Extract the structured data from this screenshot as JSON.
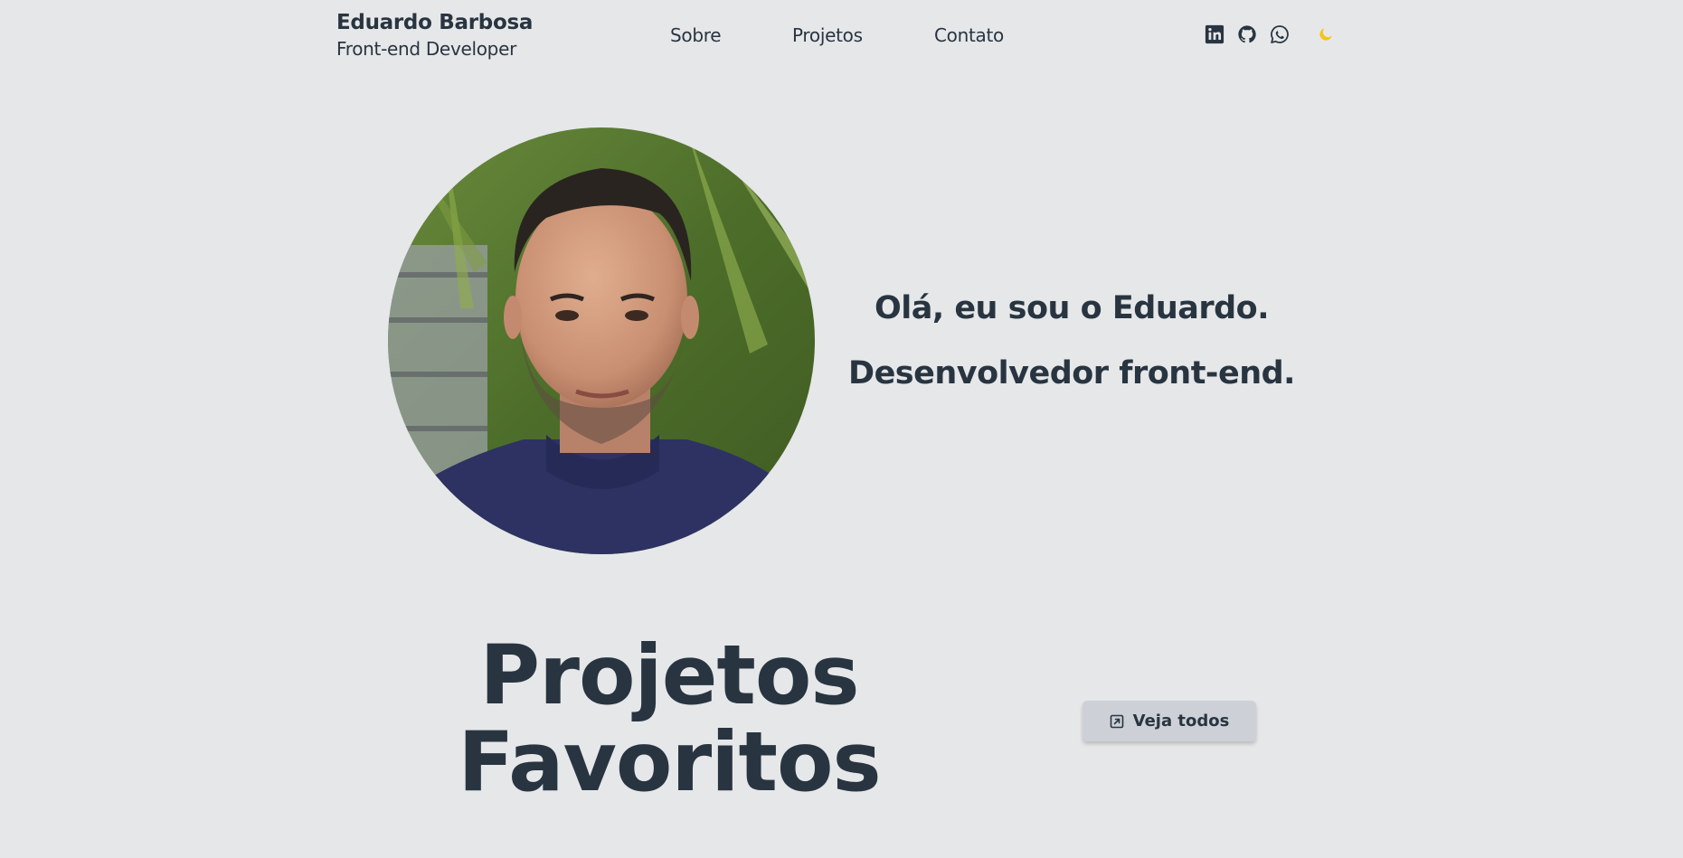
{
  "header": {
    "name": "Eduardo Barbosa",
    "role": "Front-end Developer",
    "nav": [
      "Sobre",
      "Projetos",
      "Contato"
    ],
    "social_icons": [
      "linkedin-icon",
      "github-icon",
      "whatsapp-icon"
    ],
    "theme_icon": "moon-icon"
  },
  "hero": {
    "photo": "profile-photo",
    "greeting": "Olá, eu sou o Eduardo.",
    "subtitle": "Desenvolvedor front-end."
  },
  "projects": {
    "title": "Projetos Favoritos",
    "view_all_label": "Veja todos",
    "view_all_icon": "external-link-icon"
  },
  "colors": {
    "background": "#e6e7e9",
    "text": "#283541",
    "button_bg": "#cdd0d7",
    "moon": "#f5c518"
  }
}
